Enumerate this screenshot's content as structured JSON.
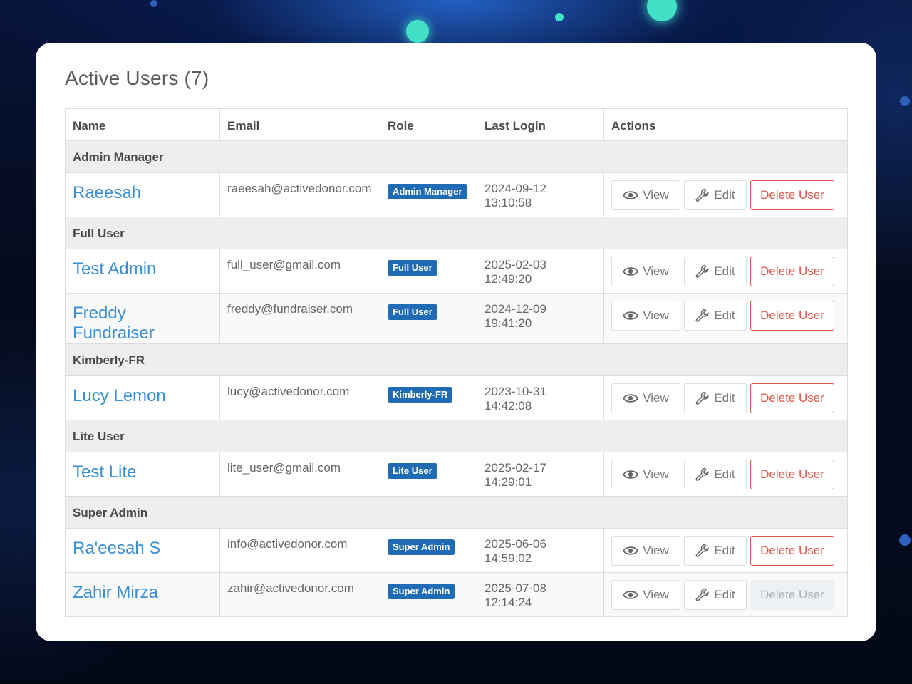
{
  "title": "Active Users (7)",
  "columns": [
    "Name",
    "Email",
    "Role",
    "Last Login",
    "Actions"
  ],
  "actions": {
    "view": "View",
    "edit": "Edit",
    "delete": "Delete User"
  },
  "colors": {
    "link": "#3a8fd6",
    "badge": "#1f6cb5",
    "danger": "#e0554a"
  },
  "groups": [
    {
      "label": "Admin Manager",
      "users": [
        {
          "name": "Raeesah",
          "email": "raeesah@activedonor.com",
          "role": "Admin Manager",
          "last_login": "2024-09-12 13:10:58",
          "delete_disabled": false
        }
      ]
    },
    {
      "label": "Full User",
      "users": [
        {
          "name": "Test Admin",
          "email": "full_user@gmail.com",
          "role": "Full User",
          "last_login": "2025-02-03 12:49:20",
          "delete_disabled": false
        },
        {
          "name": "Freddy Fundraiser",
          "email": "freddy@fundraiser.com",
          "role": "Full User",
          "last_login": "2024-12-09 19:41:20",
          "delete_disabled": false
        }
      ]
    },
    {
      "label": "Kimberly-FR",
      "users": [
        {
          "name": "Lucy Lemon",
          "email": "lucy@activedonor.com",
          "role": "Kimberly-FR",
          "last_login": "2023-10-31 14:42:08",
          "delete_disabled": false
        }
      ]
    },
    {
      "label": "Lite User",
      "users": [
        {
          "name": "Test Lite",
          "email": "lite_user@gmail.com",
          "role": "Lite User",
          "last_login": "2025-02-17 14:29:01",
          "delete_disabled": false
        }
      ]
    },
    {
      "label": "Super Admin",
      "users": [
        {
          "name": "Ra'eesah S",
          "email": "info@activedonor.com",
          "role": "Super Admin",
          "last_login": "2025-06-06 14:59:02",
          "delete_disabled": false
        },
        {
          "name": "Zahir Mirza",
          "email": "zahir@activedonor.com",
          "role": "Super Admin",
          "last_login": "2025-07-08 12:14:24",
          "delete_disabled": true
        }
      ]
    }
  ]
}
